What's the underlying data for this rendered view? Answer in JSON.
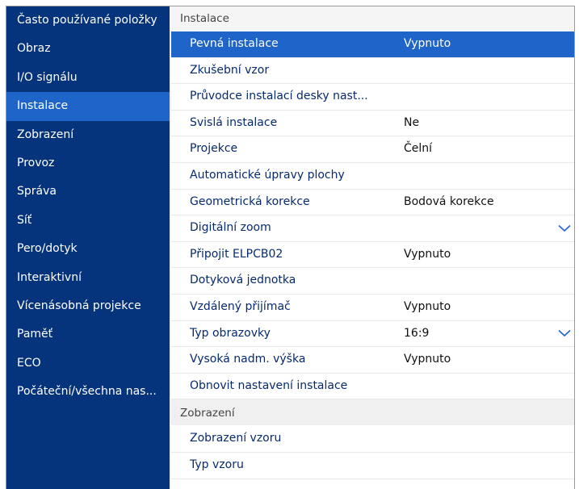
{
  "sidebar": {
    "items": [
      {
        "label": "Často používané položky"
      },
      {
        "label": "Obraz"
      },
      {
        "label": "I/O signálu"
      },
      {
        "label": "Instalace"
      },
      {
        "label": "Zobrazení"
      },
      {
        "label": "Provoz"
      },
      {
        "label": "Správa"
      },
      {
        "label": "Síť"
      },
      {
        "label": "Pero/dotyk"
      },
      {
        "label": "Interaktivní"
      },
      {
        "label": "Vícenásobná projekce"
      },
      {
        "label": "Paměť"
      },
      {
        "label": "ECO"
      },
      {
        "label": "Počáteční/všechna nas..."
      }
    ],
    "active_index": 3
  },
  "main": {
    "section1": {
      "header": "Instalace",
      "rows": [
        {
          "label": "Pevná instalace",
          "value": "Vypnuto"
        },
        {
          "label": "Zkušební vzor",
          "value": ""
        },
        {
          "label": "Průvodce instalací desky nast...",
          "value": ""
        },
        {
          "label": "Svislá instalace",
          "value": "Ne"
        },
        {
          "label": "Projekce",
          "value": "Čelní"
        },
        {
          "label": "Automatické úpravy plochy",
          "value": ""
        },
        {
          "label": "Geometrická korekce",
          "value": "Bodová korekce"
        },
        {
          "label": "Digitální zoom",
          "value": ""
        },
        {
          "label": "Připojit ELPCB02",
          "value": "Vypnuto"
        },
        {
          "label": "Dotyková jednotka",
          "value": ""
        },
        {
          "label": "Vzdálený přijímač",
          "value": "Vypnuto"
        },
        {
          "label": "Typ obrazovky",
          "value": "16:9"
        },
        {
          "label": "Vysoká nadm. výška",
          "value": "Vypnuto"
        },
        {
          "label": "Obnovit nastavení instalace",
          "value": ""
        }
      ]
    },
    "section2": {
      "header": "Zobrazení",
      "rows": [
        {
          "label": "Zobrazení vzoru",
          "value": ""
        },
        {
          "label": "Typ vzoru",
          "value": ""
        }
      ]
    }
  },
  "colors": {
    "sidebar_bg": "#05347d",
    "highlight": "#1f64c8",
    "row_text": "#062a6e"
  }
}
